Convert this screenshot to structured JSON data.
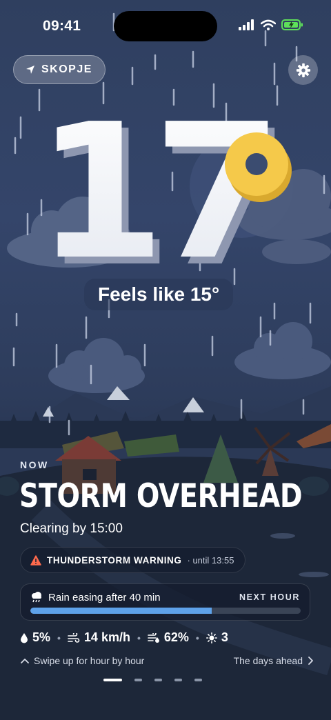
{
  "status": {
    "time": "09:41"
  },
  "location": {
    "label": "SKOPJE"
  },
  "weather": {
    "temperature": "17",
    "feels_like": "Feels like 15°",
    "now_label": "NOW",
    "condition": "STORM OVERHEAD",
    "clearing": "Clearing by 15:00"
  },
  "warning": {
    "title": "THUNDERSTORM WARNING",
    "until": "· until 13:55"
  },
  "next_hour": {
    "label": "Rain easing after 40 min",
    "tag": "NEXT HOUR",
    "progress": 0.67
  },
  "stats": {
    "precip": "5%",
    "wind": "14 km/h",
    "humidity": "62%",
    "uv": "3"
  },
  "footer": {
    "swipe": "Swipe up for hour by hour",
    "days": "The days ahead"
  },
  "pager": {
    "count": 5,
    "active": 0
  },
  "colors": {
    "accent_blue": "#5ea2ea",
    "warning_orange": "#ff6a4d",
    "sun_yellow": "#f5c94a",
    "background": "#2f3f5f"
  }
}
